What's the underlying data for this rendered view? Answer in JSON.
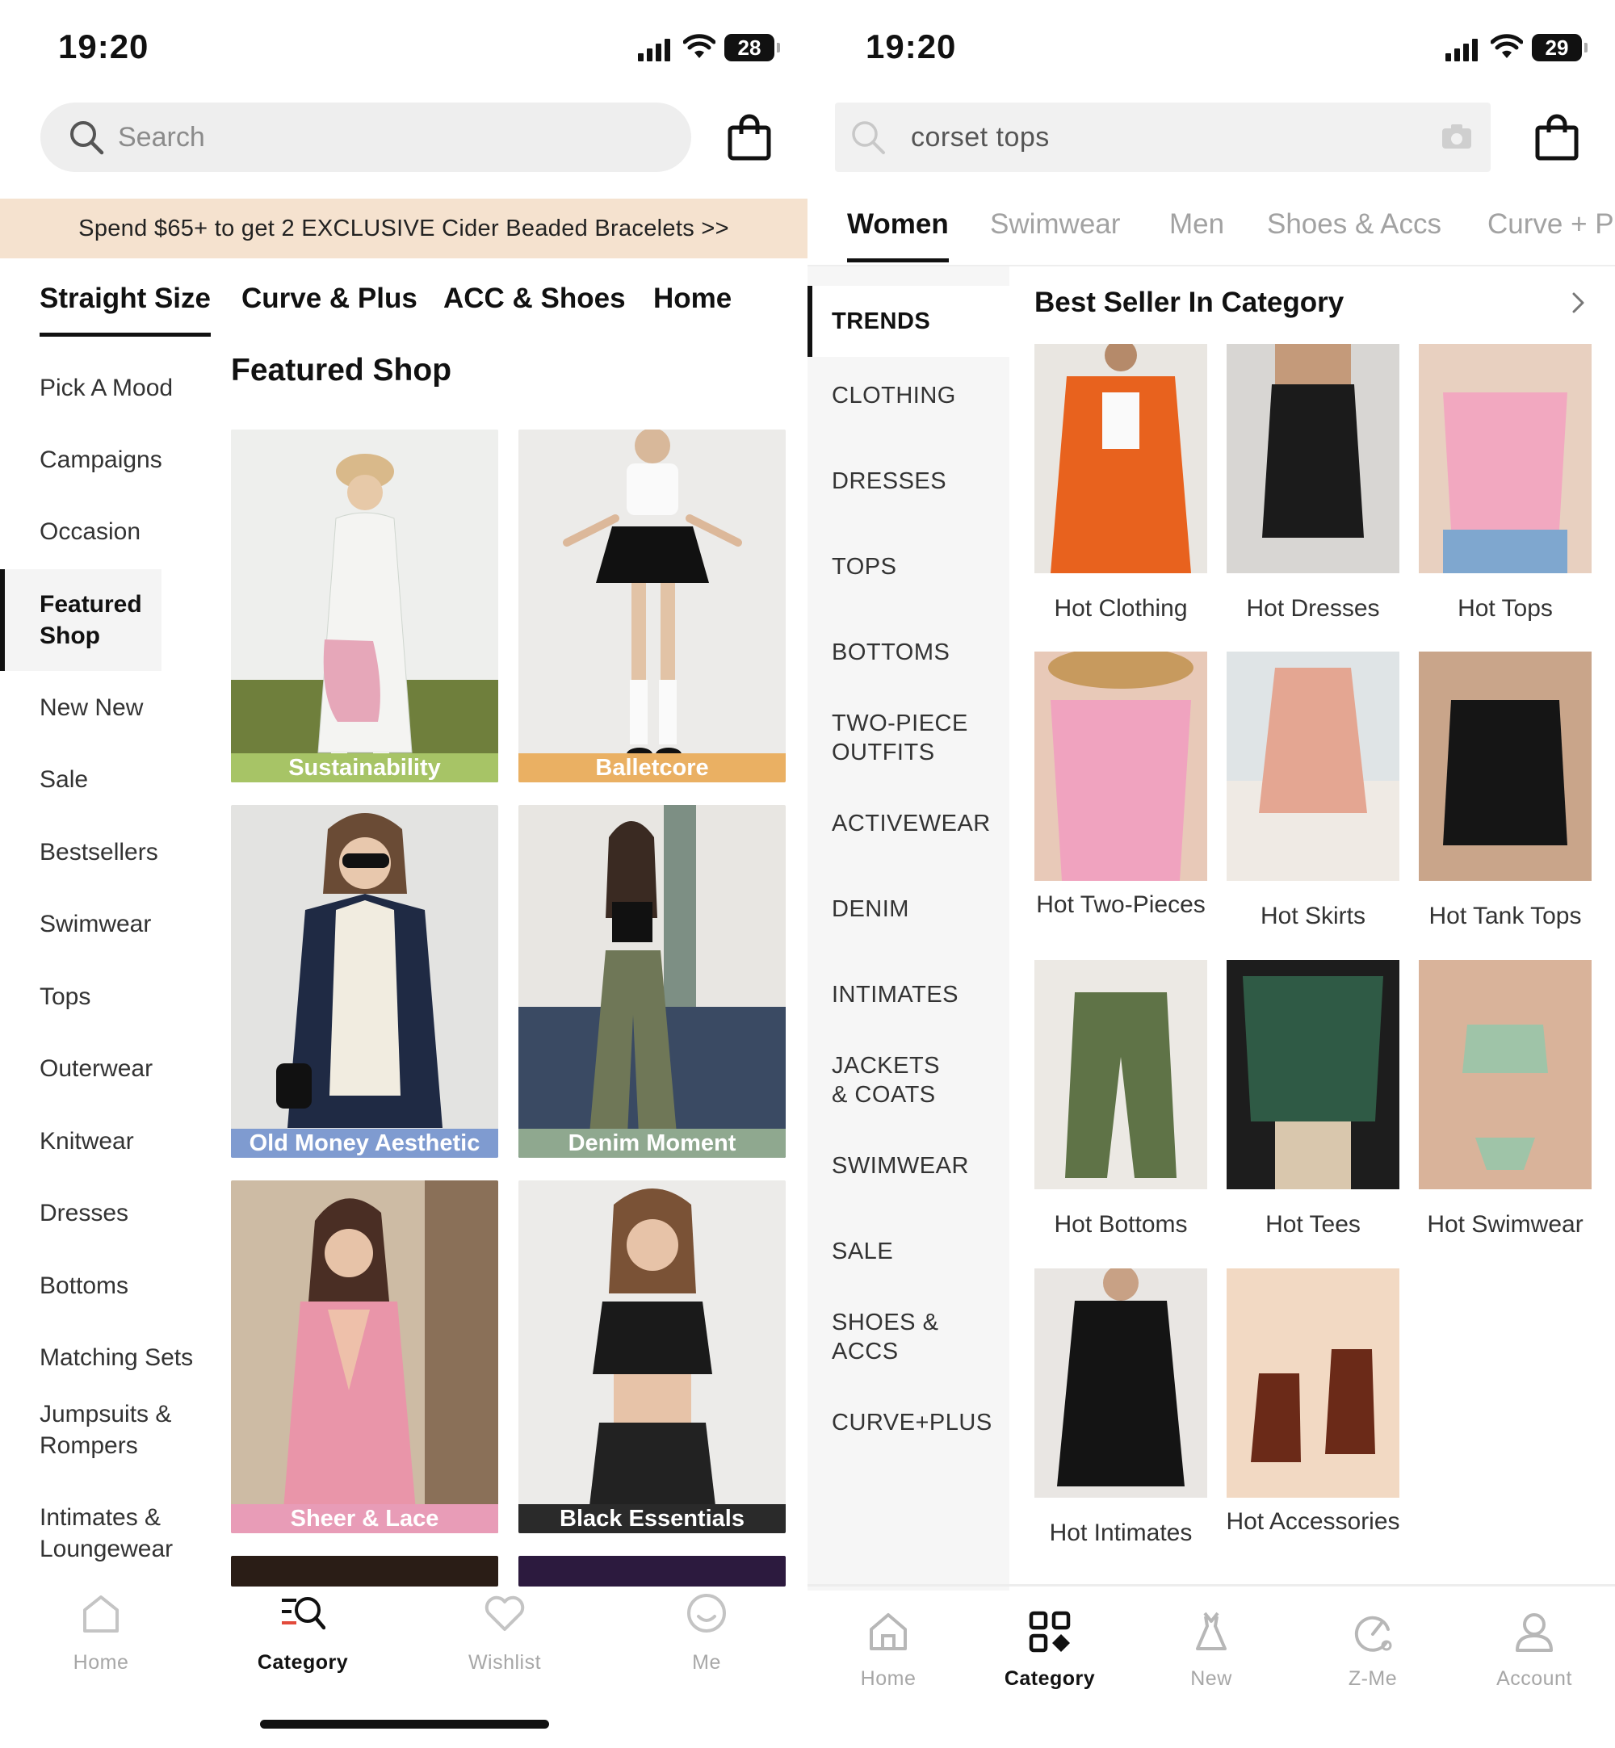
{
  "left_screen": {
    "status": {
      "time": "19:20",
      "battery": "28"
    },
    "search": {
      "placeholder": "Search"
    },
    "promo_banner": "Spend $65+ to get 2 EXCLUSIVE Cider Beaded Bracelets >>",
    "top_tabs": [
      "Straight Size",
      "Curve & Plus",
      "ACC & Shoes",
      "Home"
    ],
    "sidebar": [
      "Pick A Mood",
      "Campaigns",
      "Occasion",
      "Featured Shop",
      "New New",
      "Sale",
      "Bestsellers",
      "Swimwear",
      "Tops",
      "Outerwear",
      "Knitwear",
      "Dresses",
      "Bottoms",
      "Matching Sets",
      "Jumpsuits & Rompers",
      "Intimates & Loungewear"
    ],
    "active_sidebar": "Featured Shop",
    "section_title": "Featured Shop",
    "tiles": [
      {
        "label": "Sustainability",
        "color": "#a7c466"
      },
      {
        "label": "Balletcore",
        "color": "#eab063"
      },
      {
        "label": "Old Money Aesthetic",
        "color": "#7f9bd0"
      },
      {
        "label": "Denim Moment",
        "color": "#8fa88f"
      },
      {
        "label": "Sheer & Lace",
        "color": "#e89cb7"
      },
      {
        "label": "Black Essentials",
        "color": "#2a2a2a"
      }
    ],
    "tabbar": [
      "Home",
      "Category",
      "Wishlist",
      "Me"
    ],
    "active_tab": "Category"
  },
  "right_screen": {
    "status": {
      "time": "19:20",
      "battery": "29"
    },
    "search": {
      "value": "corset tops"
    },
    "top_tabs": [
      "Women",
      "Swimwear",
      "Men",
      "Shoes & Accs",
      "Curve + Pl"
    ],
    "sidebar": [
      "TRENDS",
      "CLOTHING",
      "DRESSES",
      "TOPS",
      "BOTTOMS",
      "TWO-PIECE OUTFITS",
      "ACTIVEWEAR",
      "DENIM",
      "INTIMATES",
      "JACKETS & COATS",
      "SWIMWEAR",
      "SALE",
      "SHOES & ACCS",
      "CURVE+PLUS"
    ],
    "active_sidebar": "TRENDS",
    "section_title": "Best Seller In Category",
    "categories": [
      "Hot Clothing",
      "Hot Dresses",
      "Hot Tops",
      "Hot Two-Pieces",
      "Hot Skirts",
      "Hot Tank Tops",
      "Hot Bottoms",
      "Hot Tees",
      "Hot Swimwear",
      "Hot Intimates",
      "Hot Accessories"
    ],
    "tabbar": [
      "Home",
      "Category",
      "New",
      "Z-Me",
      "Account"
    ],
    "active_tab": "Category"
  }
}
